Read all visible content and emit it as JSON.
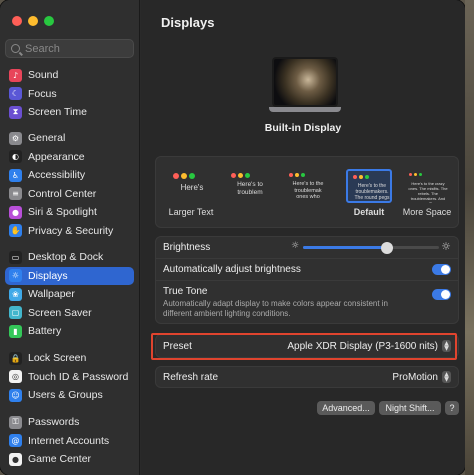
{
  "window": {
    "title": "Displays"
  },
  "search": {
    "placeholder": "Search"
  },
  "sidebar": {
    "items": [
      {
        "label": "Sound",
        "icon": "speaker-icon",
        "color": "#e8455a"
      },
      {
        "label": "Focus",
        "icon": "moon-icon",
        "color": "#5a57d6"
      },
      {
        "label": "Screen Time",
        "icon": "hourglass-icon",
        "color": "#6b4fd1"
      },
      {
        "label": "General",
        "icon": "gear-icon",
        "color": "#8a8a8e"
      },
      {
        "label": "Appearance",
        "icon": "appearance-icon",
        "color": "#222222"
      },
      {
        "label": "Accessibility",
        "icon": "accessibility-icon",
        "color": "#2f80ed"
      },
      {
        "label": "Control Center",
        "icon": "control-center-icon",
        "color": "#8a8a8e"
      },
      {
        "label": "Siri & Spotlight",
        "icon": "siri-icon",
        "color": "#b84fd8"
      },
      {
        "label": "Privacy & Security",
        "icon": "hand-icon",
        "color": "#2f80ed"
      },
      {
        "label": "Desktop & Dock",
        "icon": "dock-icon",
        "color": "#222222"
      },
      {
        "label": "Displays",
        "icon": "sun-icon",
        "color": "#2f80ed"
      },
      {
        "label": "Wallpaper",
        "icon": "wallpaper-icon",
        "color": "#3fa9e8"
      },
      {
        "label": "Screen Saver",
        "icon": "screen-saver-icon",
        "color": "#43b6cc"
      },
      {
        "label": "Battery",
        "icon": "battery-icon",
        "color": "#34c759"
      },
      {
        "label": "Lock Screen",
        "icon": "lock-icon",
        "color": "#222222"
      },
      {
        "label": "Touch ID & Password",
        "icon": "fingerprint-icon",
        "color": "#f2f2f2"
      },
      {
        "label": "Users & Groups",
        "icon": "users-icon",
        "color": "#2f80ed"
      },
      {
        "label": "Passwords",
        "icon": "key-icon",
        "color": "#8a8a8e"
      },
      {
        "label": "Internet Accounts",
        "icon": "at-icon",
        "color": "#2f80ed"
      },
      {
        "label": "Game Center",
        "icon": "game-center-icon",
        "color": "#f2f2f2"
      }
    ],
    "active": "Displays"
  },
  "display": {
    "name": "Built-in Display"
  },
  "resolution": {
    "options": [
      {
        "label": "Larger Text",
        "preview": "Here's"
      },
      {
        "label": "",
        "preview": "Here's to troublem"
      },
      {
        "label": "",
        "preview": "Here's to the troublemak ones who"
      },
      {
        "label": "Default",
        "preview": "Here's to the troublemakers. The round pegs"
      },
      {
        "label": "More Space",
        "preview": "Here's to the crazy ones. The misfits. The rebels. The troublemakers. And pegs. They"
      }
    ],
    "selected": "Default"
  },
  "brightness": {
    "label": "Brightness",
    "level": 0.62
  },
  "auto_brightness": {
    "label": "Automatically adjust brightness",
    "enabled": true
  },
  "true_tone": {
    "label": "True Tone",
    "description": "Automatically adapt display to make colors appear consistent in different ambient lighting conditions.",
    "enabled": true
  },
  "preset": {
    "label": "Preset",
    "value": "Apple XDR Display (P3-1600 nits)"
  },
  "refresh_rate": {
    "label": "Refresh rate",
    "value": "ProMotion"
  },
  "buttons": {
    "advanced": "Advanced...",
    "night_shift": "Night Shift..."
  },
  "colors": {
    "accent": "#3b7ae6",
    "highlight_border": "#e0442e"
  }
}
